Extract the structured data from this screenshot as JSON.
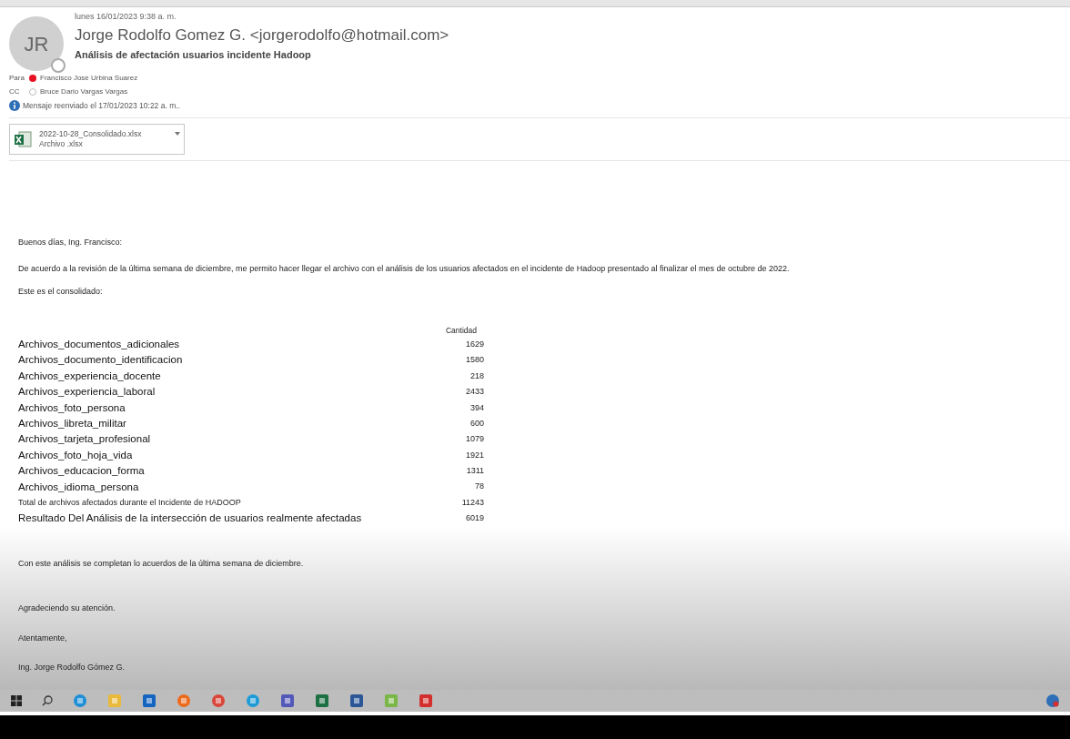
{
  "header": {
    "date": "lunes 16/01/2023 9:38 a. m.",
    "avatar_initials": "JR",
    "sender": "Jorge Rodolfo Gomez G. <jorgerodolfo@hotmail.com>",
    "subject": "Análisis de afectación usuarios incidente Hadoop",
    "recipients": [
      {
        "label": "Para",
        "name": "Francisco Jose Urbina Suarez",
        "kind": "dot",
        "color": "#e81123"
      },
      {
        "label": "CC",
        "name": "Bruce Dario Vargas Vargas",
        "kind": "ring",
        "color": "#bbbbbb"
      }
    ],
    "forwarded_note": "Mensaje reenviado el 17/01/2023 10:22 a. m..",
    "attachment": {
      "name": "2022-10-28_Consolidado.xlsx",
      "type": "Archivo .xlsx"
    }
  },
  "body": {
    "greeting": "Buenos días, Ing. Francisco:",
    "paragraph": "De acuerdo a la revisión de la última semana de diciembre, me permito hacer llegar el archivo con el análisis de los usuarios afectados en el incidente de Hadoop presentado al finalizar el mes de octubre de 2022.",
    "intro": "Este es el consolidado:",
    "table": {
      "header": "Cantidad",
      "rows": [
        {
          "label": "Archivos_documentos_adicionales",
          "value": "1629",
          "kind": "large"
        },
        {
          "label": "Archivos_documento_identificacion",
          "value": "1580",
          "kind": "large"
        },
        {
          "label": "Archivos_experiencia_docente",
          "value": "218",
          "kind": "large"
        },
        {
          "label": "Archivos_experiencia_laboral",
          "value": "2433",
          "kind": "large"
        },
        {
          "label": "Archivos_foto_persona",
          "value": "394",
          "kind": "large"
        },
        {
          "label": "Archivos_libreta_militar",
          "value": "600",
          "kind": "large"
        },
        {
          "label": "Archivos_tarjeta_profesional",
          "value": "1079",
          "kind": "large"
        },
        {
          "label": "Archivos_foto_hoja_vida",
          "value": "1921",
          "kind": "large"
        },
        {
          "label": "Archivos_educacion_forma",
          "value": "1311",
          "kind": "large"
        },
        {
          "label": "Archivos_idioma_persona",
          "value": "78",
          "kind": "large"
        },
        {
          "label": "Total de archivos afectados durante el Incidente de HADOOP",
          "value": "11243",
          "kind": "small"
        },
        {
          "label": "Resultado Del Análisis de la intersección de usuarios realmente afectadas",
          "value": "6019",
          "kind": "large"
        }
      ]
    },
    "closing": "Con este análisis se completan  lo acuerdos de la última semana de diciembre.",
    "thanks": "Agradeciendo su atención.",
    "sign_off": "Atentamente,",
    "signature": "Ing. Jorge Rodolfo Gómez G."
  }
}
